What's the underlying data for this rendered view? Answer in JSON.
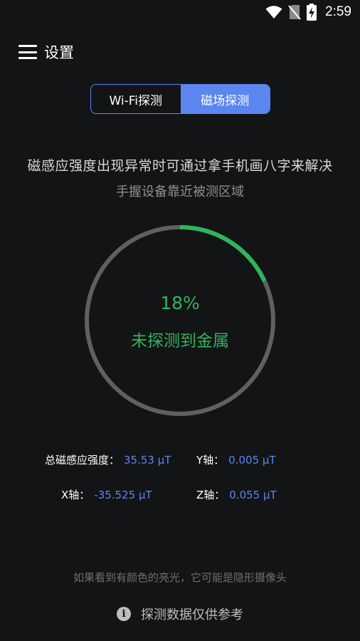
{
  "status_bar": {
    "time": "2:59",
    "icons": [
      "wifi-icon",
      "no-sim-icon",
      "battery-charging-icon"
    ]
  },
  "header": {
    "menu_icon": "hamburger-menu-icon",
    "title": "设置"
  },
  "tabs": [
    {
      "label": "Wi-Fi探测",
      "active": false
    },
    {
      "label": "磁场探测",
      "active": true
    }
  ],
  "instructions": {
    "main": "磁感应强度出现异常时可通过拿手机画八字来解决",
    "sub": "手握设备靠近被测区域"
  },
  "gauge": {
    "percent_text": "18%",
    "progress": 0.18,
    "status": "未探测到金属",
    "track_color": "#5f6062",
    "progress_color": "#2fb55a"
  },
  "readings": {
    "total": {
      "label": "总磁感应强度：",
      "value": "35.53 μT"
    },
    "y": {
      "label": "Y轴：",
      "value": "0.005 μT"
    },
    "x": {
      "label": "X轴：",
      "value": "-35.525 μT"
    },
    "z": {
      "label": "Z轴：",
      "value": "0.055 μT"
    }
  },
  "footer": {
    "hint": "如果看到有颜色的亮光，它可能是隐形摄像头",
    "note": "探测数据仅供参考",
    "info_icon": "info-icon"
  },
  "colors": {
    "accent": "#5b86f0",
    "success": "#2fb55a",
    "background": "#131416"
  }
}
